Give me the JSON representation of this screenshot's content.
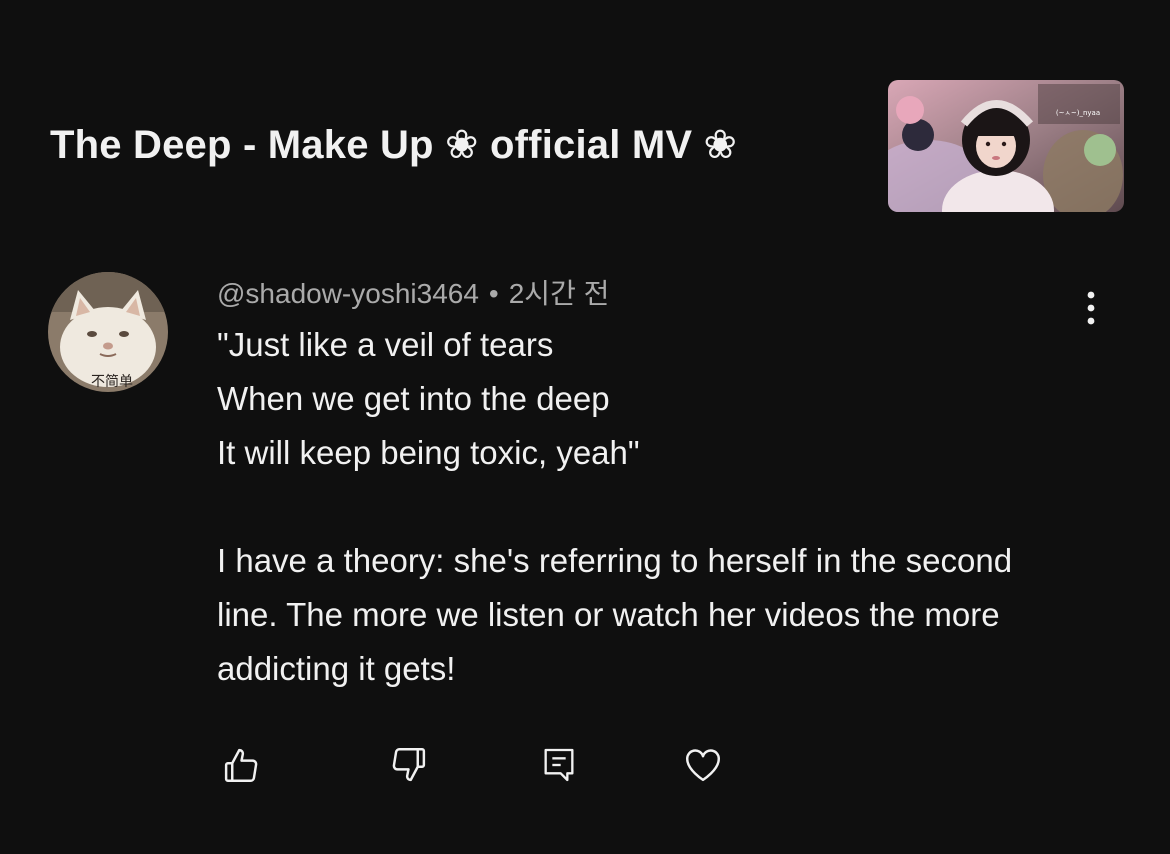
{
  "video": {
    "title": "The Deep -  Make Up ❀ official MV ❀",
    "thumbnail_caption": "(~ㅅ~)_nyaa"
  },
  "comment": {
    "handle": "@shadow-yoshi3464",
    "separator": "•",
    "time": "2시간 전",
    "avatar_caption": "不简单",
    "text": "\"Just like a veil of tears\nWhen we get into the deep\nIt will keep being toxic, yeah\"\n\nI have a theory: she's referring to herself in the second line. The more we listen or watch her videos the more addicting it gets!"
  },
  "actions": {
    "like_icon": "thumbs-up-icon",
    "dislike_icon": "thumbs-down-icon",
    "reply_icon": "comment-icon",
    "heart_icon": "heart-icon"
  },
  "colors": {
    "background": "#0f0f0f",
    "primary_text": "#f1f1f1",
    "secondary_text": "#aaaaaa"
  }
}
